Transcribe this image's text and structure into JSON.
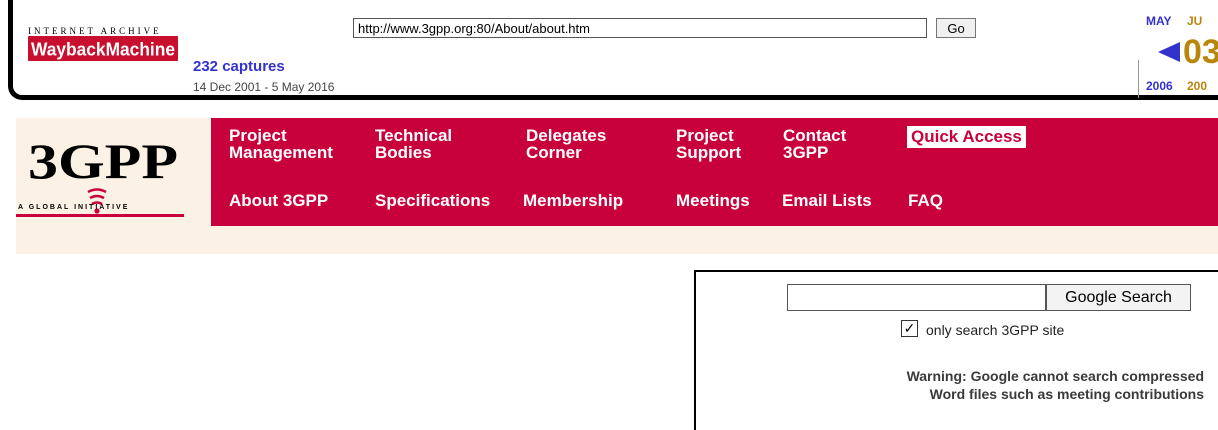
{
  "wayback": {
    "brand_top": "INTERNET ARCHIVE",
    "brand_name": "WaybackMachine",
    "url_value": "http://www.3gpp.org:80/About/about.htm",
    "go_label": "Go",
    "captures": "232 captures",
    "date_range": "14 Dec 2001 - 5 May 2016",
    "month_prev": "MAY",
    "month_current": "JU",
    "day": "03",
    "year_prev": "2006",
    "year_current": "200",
    "colors": {
      "link_blue": "#3333cc",
      "gold": "#b8860b"
    }
  },
  "site": {
    "logo_text": "3GPP",
    "tagline": "A GLOBAL INITIATIVE",
    "nav_top": [
      {
        "line1": "Project",
        "line2": "Management"
      },
      {
        "line1": "Technical",
        "line2": "Bodies"
      },
      {
        "line1": "Delegates",
        "line2": "Corner"
      },
      {
        "line1": "Project",
        "line2": "Support"
      },
      {
        "line1": "Contact",
        "line2": "3GPP"
      }
    ],
    "quick_access": "Quick Access",
    "nav_bottom": [
      "About 3GPP",
      "Specifications",
      "Membership",
      "Meetings",
      "Email Lists",
      "FAQ"
    ],
    "colors": {
      "brand_red": "#c8003b",
      "cream": "#fbf2e5"
    }
  },
  "search": {
    "input_value": "",
    "button_label": "Google Search",
    "checkbox_checked": true,
    "checkbox_mark": "✓",
    "checkbox_label": "only search 3GPP site",
    "warning_line1": "Warning: Google cannot search compressed",
    "warning_line2": "Word files such as meeting contributions"
  }
}
